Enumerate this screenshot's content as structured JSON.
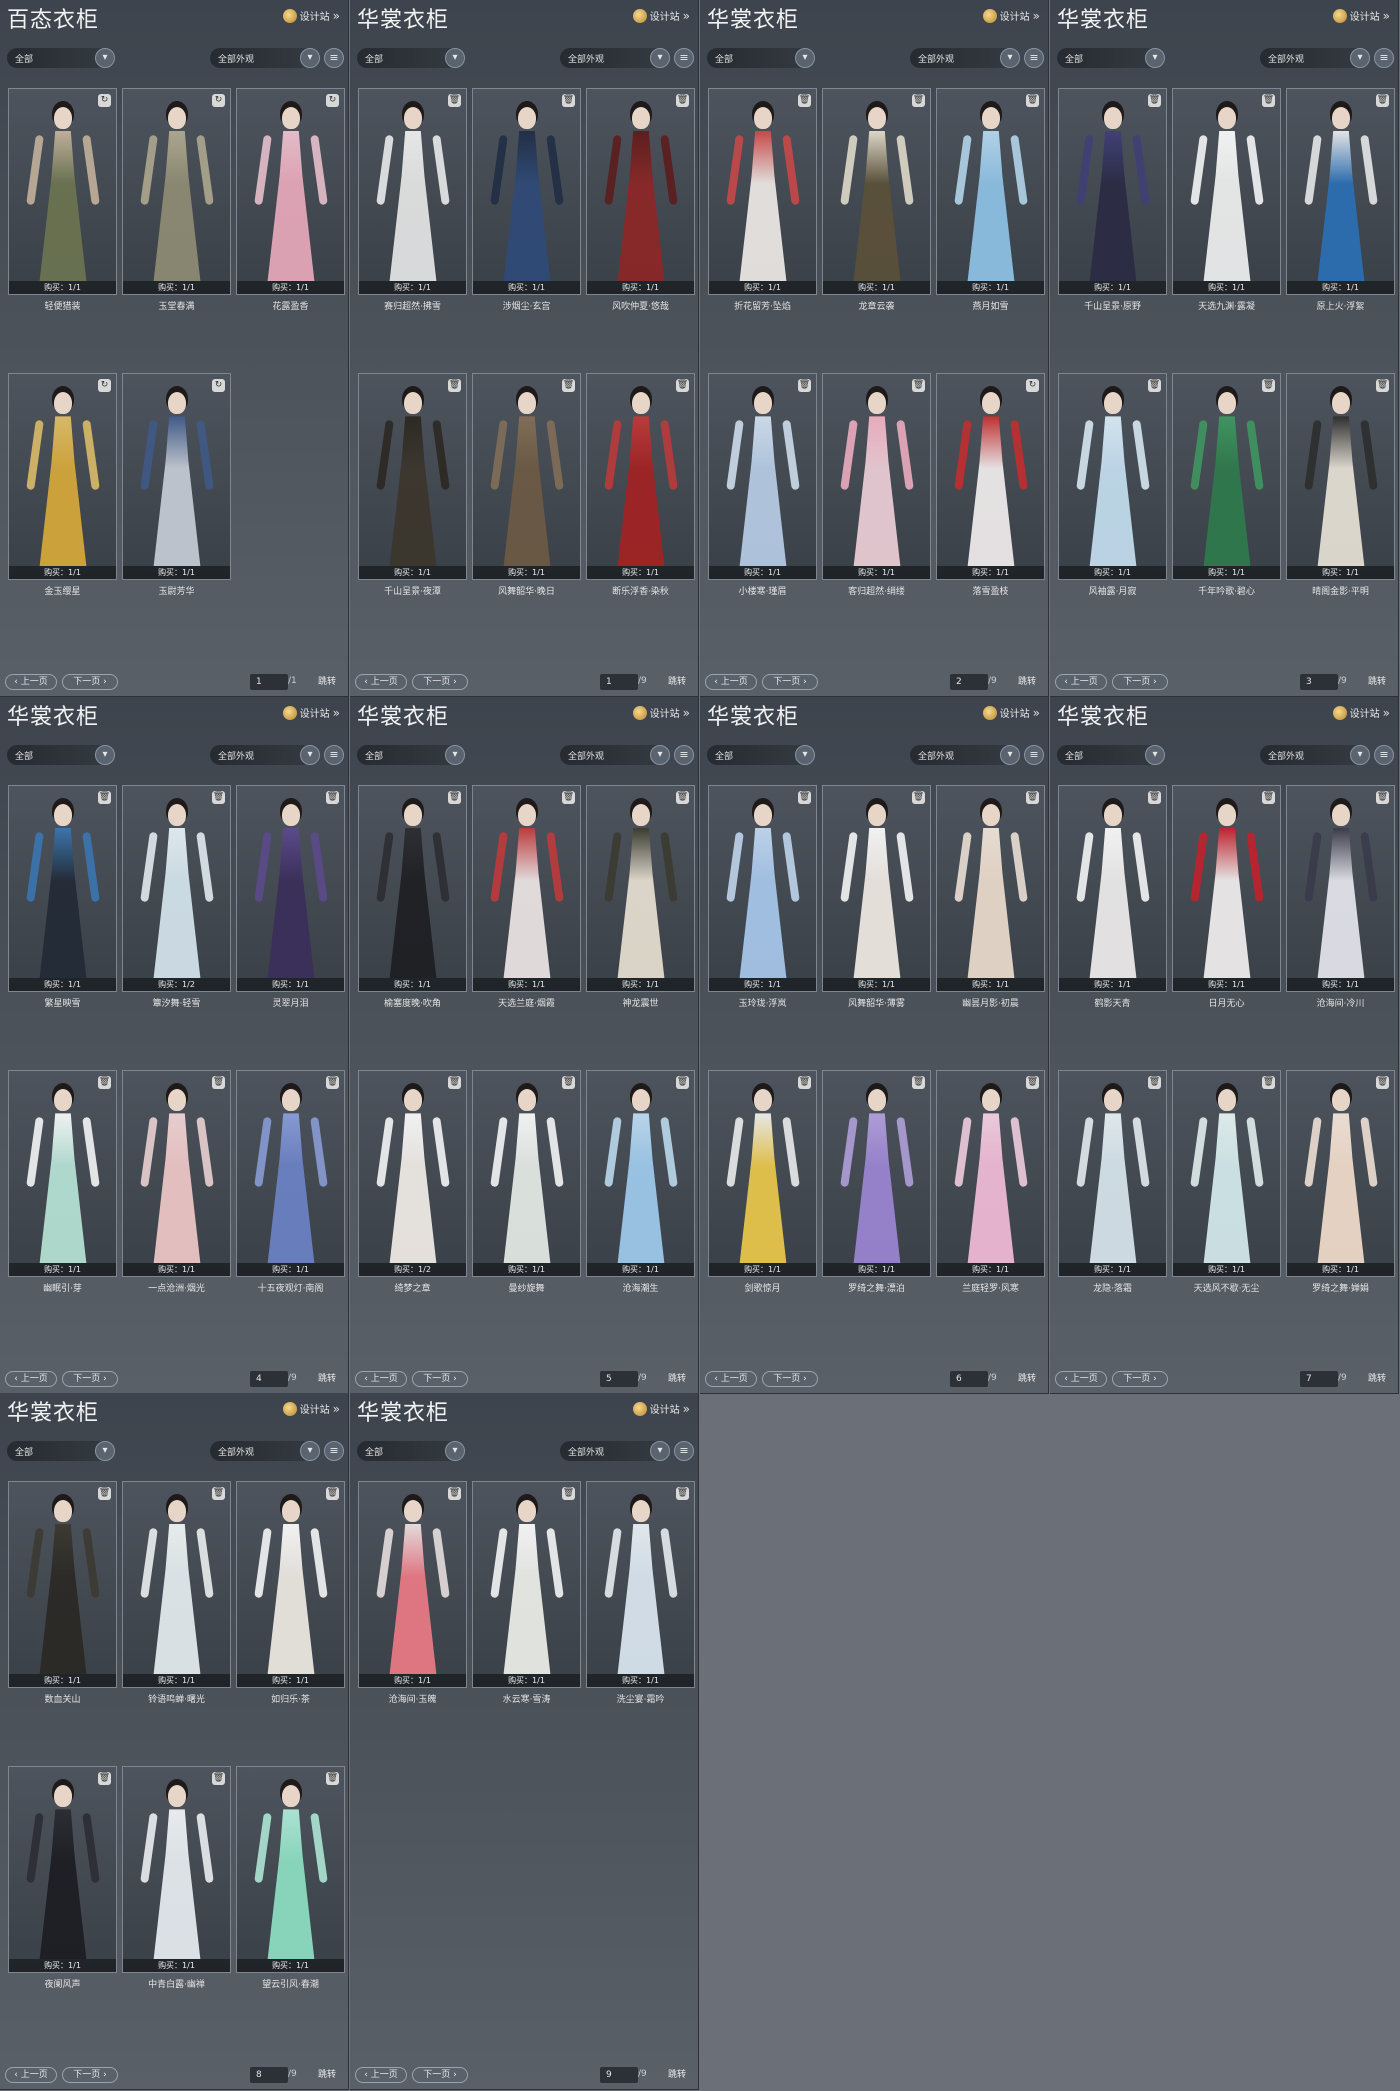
{
  "common": {
    "design_label": "设计站",
    "filter_all": "全部",
    "filter_appearance": "全部外观",
    "prev_label": "上一页",
    "next_label": "下一页",
    "jump_label": "跳转"
  },
  "panels": [
    {
      "title": "百态衣柜",
      "page": "1",
      "total": "/1",
      "items": [
        {
          "name": "轻便猎装",
          "buy": "购买：1/1",
          "icon": "refresh-icon",
          "color": "#6b7450",
          "arm": "#c9b7a0"
        },
        {
          "name": "玉堂春满",
          "buy": "购买：1/1",
          "icon": "refresh-icon",
          "color": "#8f8c74",
          "arm": "#b3ad92"
        },
        {
          "name": "花露盈香",
          "buy": "购买：1/1",
          "icon": "refresh-icon",
          "color": "#e8a9bc",
          "arm": "#f0c6d2"
        },
        {
          "name": "金玉缨星",
          "buy": "购买：1/1",
          "icon": "refresh-icon",
          "color": "#d7a93a",
          "arm": "#e3c26a"
        },
        {
          "name": "玉尉芳华",
          "buy": "购买：1/1",
          "icon": "refresh-icon",
          "color": "#c7cdd7",
          "arm": "#3f5a8a"
        }
      ]
    },
    {
      "title": "华裳衣柜",
      "page": "1",
      "total": "/9",
      "items": [
        {
          "name": "赛归超然·拂雪",
          "buy": "购买：1/1",
          "icon": "trash-icon",
          "color": "#e6e6e6",
          "arm": "#f3f3f3"
        },
        {
          "name": "涉烟尘·玄宫",
          "buy": "购买：1/1",
          "icon": "trash-icon",
          "color": "#2e4a78",
          "arm": "#1f2c44"
        },
        {
          "name": "风吹仲夏·悠哉",
          "buy": "购买：1/1",
          "icon": "trash-icon",
          "color": "#8d2626",
          "arm": "#5e1a1a"
        },
        {
          "name": "千山呈景·夜潭",
          "buy": "购买：1/1",
          "icon": "trash-icon",
          "color": "#3b352c",
          "arm": "#2a2620"
        },
        {
          "name": "风舞韶华·晚日",
          "buy": "购买：1/1",
          "icon": "trash-icon",
          "color": "#6c5a44",
          "arm": "#857058"
        },
        {
          "name": "断乐浮香·染秋",
          "buy": "购买：1/1",
          "icon": "trash-icon",
          "color": "#a32222",
          "arm": "#c13a3a"
        }
      ]
    },
    {
      "title": "华裳衣柜",
      "page": "2",
      "total": "/9",
      "items": [
        {
          "name": "折花留芳·坠焰",
          "buy": "购买：1/1",
          "icon": "trash-icon",
          "color": "#eeeae6",
          "arm": "#d04848"
        },
        {
          "name": "龙章云袭",
          "buy": "购买：1/1",
          "icon": "trash-icon",
          "color": "#5b5038",
          "arm": "#e8e2d0"
        },
        {
          "name": "燕月如雪",
          "buy": "购买：1/1",
          "icon": "trash-icon",
          "color": "#8fc3e6",
          "arm": "#b9dcf2"
        },
        {
          "name": "小楼寒·瑾眉",
          "buy": "购买：1/1",
          "icon": "trash-icon",
          "color": "#b7cde6",
          "arm": "#d6e4f3"
        },
        {
          "name": "客归超然·绡缕",
          "buy": "购买：1/1",
          "icon": "trash-icon",
          "color": "#eecfd8",
          "arm": "#f5b2c4"
        },
        {
          "name": "落雪盈枝",
          "buy": "购买：1/1",
          "icon": "refresh-icon",
          "color": "#f2eeee",
          "arm": "#c92c2c"
        }
      ]
    },
    {
      "title": "华裳衣柜",
      "page": "3",
      "total": "/9",
      "items": [
        {
          "name": "千山呈景·原野",
          "buy": "购买：1/1",
          "icon": "trash-icon",
          "color": "#2a2a44",
          "arm": "#3f3f78"
        },
        {
          "name": "天选九渊·露凝",
          "buy": "购买：1/1",
          "icon": "trash-icon",
          "color": "#f1f1f1",
          "arm": "#ffffff"
        },
        {
          "name": "原上火·浮絮",
          "buy": "购买：1/1",
          "icon": "trash-icon",
          "color": "#2a6fb5",
          "arm": "#f0f0f0"
        },
        {
          "name": "风袖露·月寂",
          "buy": "购买：1/1",
          "icon": "trash-icon",
          "color": "#c5dff0",
          "arm": "#def0fa"
        },
        {
          "name": "千年吟歌·碧心",
          "buy": "购买：1/1",
          "icon": "trash-icon",
          "color": "#2f7a4c",
          "arm": "#3f9a62"
        },
        {
          "name": "晴阁金影·平明",
          "buy": "购买：1/1",
          "icon": "trash-icon",
          "color": "#e8e2d6",
          "arm": "#2b2b2b"
        }
      ]
    },
    {
      "title": "华裳衣柜",
      "page": "4",
      "total": "/9",
      "items": [
        {
          "name": "繁星映雪",
          "buy": "购买：1/1",
          "icon": "trash-icon",
          "color": "#222a36",
          "arm": "#3a78b5"
        },
        {
          "name": "簟汐舞·轻雪",
          "buy": "购买：1/2",
          "icon": "trash-icon",
          "color": "#d6e6ee",
          "arm": "#eaf3f8"
        },
        {
          "name": "灵翠月泪",
          "buy": "购买：1/1",
          "icon": "trash-icon",
          "color": "#3a2e5a",
          "arm": "#5d4a8e"
        },
        {
          "name": "幽眠引·芽",
          "buy": "购买：1/1",
          "icon": "trash-icon",
          "color": "#b8e4d6",
          "arm": "#ffffff"
        },
        {
          "name": "一点沧洲·烟光",
          "buy": "购买：1/1",
          "icon": "trash-icon",
          "color": "#f0c8c8",
          "arm": "#f5d8d8"
        },
        {
          "name": "十五夜观灯·南阁",
          "buy": "购买：1/1",
          "icon": "trash-icon",
          "color": "#6c82c6",
          "arm": "#8ca0dc"
        }
      ]
    },
    {
      "title": "华裳衣柜",
      "page": "5",
      "total": "/9",
      "items": [
        {
          "name": "榆塞度晚·吹角",
          "buy": "购买：1/1",
          "icon": "trash-icon",
          "color": "#1e1e22",
          "arm": "#2c2c30"
        },
        {
          "name": "天选兰庭·烟霞",
          "buy": "购买：1/1",
          "icon": "trash-icon",
          "color": "#eee6e6",
          "arm": "#c53a3a"
        },
        {
          "name": "神龙震世",
          "buy": "购买：1/1",
          "icon": "trash-icon",
          "color": "#e8e0d2",
          "arm": "#3a3a2e"
        },
        {
          "name": "绮梦之章",
          "buy": "购买：1/2",
          "icon": "trash-icon",
          "color": "#f2ede8",
          "arm": "#ffffff"
        },
        {
          "name": "曼纱旋舞",
          "buy": "购买：1/1",
          "icon": "trash-icon",
          "color": "#e6ece6",
          "arm": "#ffffff"
        },
        {
          "name": "沧海潮生",
          "buy": "购买：1/1",
          "icon": "trash-icon",
          "color": "#9fcbee",
          "arm": "#c3e0f6"
        }
      ]
    },
    {
      "title": "华裳衣柜",
      "page": "6",
      "total": "/9",
      "items": [
        {
          "name": "玉玲珑·浮岚",
          "buy": "购买：1/1",
          "icon": "trash-icon",
          "color": "#a8c8ec",
          "arm": "#c6dcf4"
        },
        {
          "name": "风舞韶华·薄雾",
          "buy": "购买：1/1",
          "icon": "trash-icon",
          "color": "#f2ebe4",
          "arm": "#ffffff"
        },
        {
          "name": "幽昙月影·初晨",
          "buy": "购买：1/1",
          "icon": "trash-icon",
          "color": "#ecdccc",
          "arm": "#f4e8dc"
        },
        {
          "name": "剑歌惊月",
          "buy": "购买：1/1",
          "icon": "trash-icon",
          "color": "#ecc84a",
          "arm": "#f4f4f4"
        },
        {
          "name": "罗绮之舞·漂泊",
          "buy": "购买：1/1",
          "icon": "trash-icon",
          "color": "#9c86d4",
          "arm": "#b6a4e0"
        },
        {
          "name": "兰庭轻罗·风寒",
          "buy": "购买：1/1",
          "icon": "trash-icon",
          "color": "#f2bcd8",
          "arm": "#f8d4e6"
        }
      ]
    },
    {
      "title": "华裳衣柜",
      "page": "7",
      "total": "/9",
      "items": [
        {
          "name": "鹤影天青",
          "buy": "购买：1/1",
          "icon": "trash-icon",
          "color": "#f0eeee",
          "arm": "#ffffff"
        },
        {
          "name": "日月无心",
          "buy": "购买：1/1",
          "icon": "trash-icon",
          "color": "#f2f0f0",
          "arm": "#c81f2a"
        },
        {
          "name": "沧海间·冷川",
          "buy": "购买：1/1",
          "icon": "trash-icon",
          "color": "#e6e6ee",
          "arm": "#3a3a4a"
        },
        {
          "name": "龙隐·落霜",
          "buy": "购买：1/1",
          "icon": "trash-icon",
          "color": "#d8e6ee",
          "arm": "#ecf4f8"
        },
        {
          "name": "天选风不歇·无尘",
          "buy": "购买：1/1",
          "icon": "trash-icon",
          "color": "#d6ecee",
          "arm": "#eaf6f6"
        },
        {
          "name": "罗绮之舞·婵娟",
          "buy": "购买：1/1",
          "icon": "trash-icon",
          "color": "#f2ddcc",
          "arm": "#f8e8dc"
        }
      ]
    },
    {
      "title": "华裳衣柜",
      "page": "8",
      "total": "/9",
      "items": [
        {
          "name": "数血关山",
          "buy": "购买：1/1",
          "icon": "trash-icon",
          "color": "#2a2824",
          "arm": "#3c3830"
        },
        {
          "name": "铃语鸣蝉·曙光",
          "buy": "购买：1/1",
          "icon": "trash-icon",
          "color": "#e6eef0",
          "arm": "#f4f8f8"
        },
        {
          "name": "如归乐·茶",
          "buy": "购买：1/1",
          "icon": "trash-icon",
          "color": "#efebe4",
          "arm": "#ffffff"
        },
        {
          "name": "夜阑风声",
          "buy": "购买：1/1",
          "icon": "trash-icon",
          "color": "#1c1c22",
          "arm": "#2a2a32"
        },
        {
          "name": "中青白露·幽禅",
          "buy": "购买：1/1",
          "icon": "trash-icon",
          "color": "#e8eef2",
          "arm": "#f4f8fa"
        },
        {
          "name": "望云引风·春潮",
          "buy": "购买：1/1",
          "icon": "trash-icon",
          "color": "#8ee0c4",
          "arm": "#b4eedc"
        }
      ]
    },
    {
      "title": "华裳衣柜",
      "page": "9",
      "total": "/9",
      "items": [
        {
          "name": "沧海间·玉魄",
          "buy": "购买：1/1",
          "icon": "trash-icon",
          "color": "#ec7a86",
          "arm": "#f0e6e6"
        },
        {
          "name": "水云寒·雪涛",
          "buy": "购买：1/1",
          "icon": "trash-icon",
          "color": "#eef0ea",
          "arm": "#ffffff"
        },
        {
          "name": "洗尘宴·霜吟",
          "buy": "购买：1/1",
          "icon": "trash-icon",
          "color": "#dce8f2",
          "arm": "#eef4f8"
        }
      ]
    }
  ]
}
